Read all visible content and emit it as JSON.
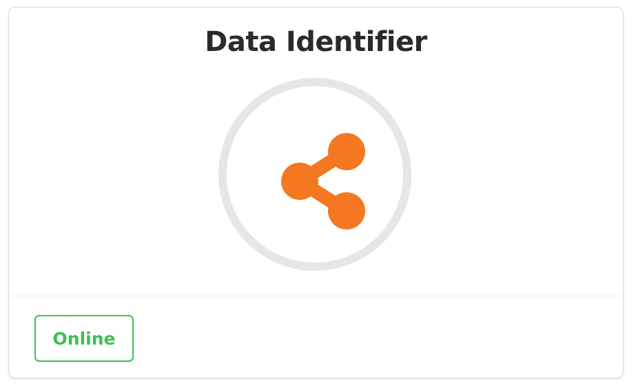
{
  "card": {
    "title": "Data Identifier",
    "icon": "share-icon",
    "status": "Online"
  },
  "colors": {
    "icon": "#f47721",
    "ring": "#e6e6e6",
    "status": "#3cbf52",
    "title": "#2b2b2b"
  }
}
